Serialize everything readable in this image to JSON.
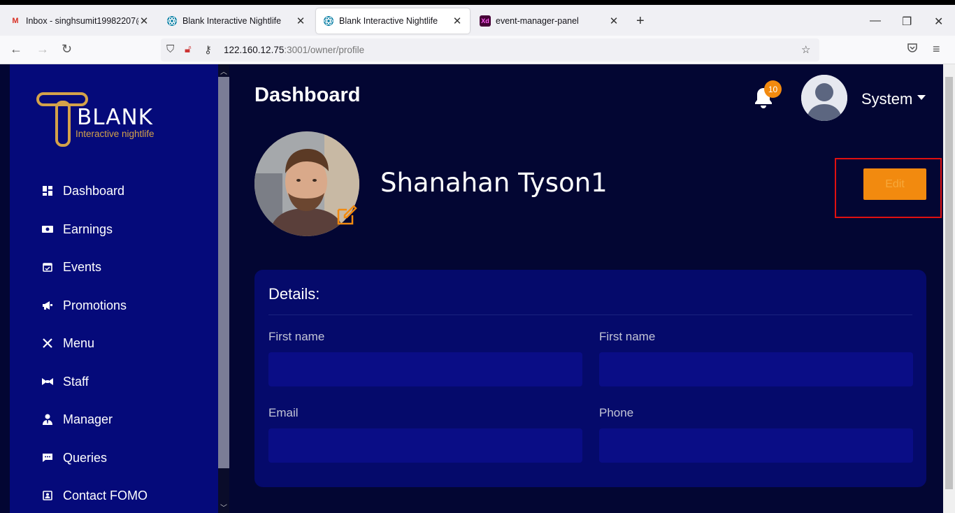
{
  "browser": {
    "tabs": [
      {
        "title": "Inbox - singhsumit19982207@g",
        "icon": "gmail-icon",
        "icon_color": "#d93025"
      },
      {
        "title": "Blank Interactive Nightlife",
        "icon": "react-icon",
        "icon_color": "#087ea4"
      },
      {
        "title": "Blank Interactive Nightlife",
        "icon": "react-icon",
        "icon_color": "#087ea4",
        "active": true
      },
      {
        "title": "event-manager-panel",
        "icon": "xd-icon",
        "icon_color": "#470137"
      }
    ],
    "url_host": "122.160.12.75",
    "url_path": ":3001/owner/profile"
  },
  "sidebar": {
    "logo_word": "BLANK",
    "logo_sub": "Interactive nightlife",
    "items": [
      {
        "label": "Dashboard",
        "icon": "dashboard-icon"
      },
      {
        "label": "Earnings",
        "icon": "money-icon"
      },
      {
        "label": "Events",
        "icon": "calendar-icon"
      },
      {
        "label": "Promotions",
        "icon": "megaphone-icon"
      },
      {
        "label": "Menu",
        "icon": "utensils-icon"
      },
      {
        "label": "Staff",
        "icon": "bowtie-icon"
      },
      {
        "label": "Manager",
        "icon": "user-tie-icon"
      },
      {
        "label": "Queries",
        "icon": "chat-icon"
      },
      {
        "label": "Contact FOMO",
        "icon": "contact-icon"
      }
    ]
  },
  "header": {
    "title": "Dashboard",
    "notification_count": "10",
    "user_name": "System"
  },
  "profile": {
    "name": "Shanahan Tyson1",
    "edit_label": "Edit"
  },
  "details": {
    "title": "Details:",
    "fields": [
      {
        "label": "First name",
        "value": ""
      },
      {
        "label": "First name",
        "value": ""
      },
      {
        "label": "Email",
        "value": ""
      },
      {
        "label": "Phone",
        "value": ""
      }
    ]
  },
  "colors": {
    "accent": "#f28a0f",
    "sidebar_bg": "#050a7a",
    "page_bg": "#030633",
    "card_bg": "#050a6b",
    "gold": "#d4a24a"
  }
}
